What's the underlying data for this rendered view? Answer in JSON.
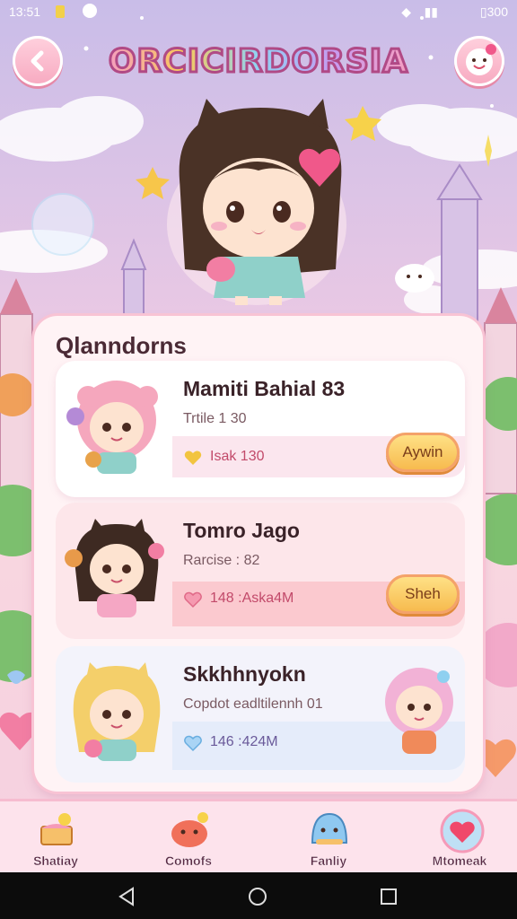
{
  "status_bar": {
    "time": "13:51",
    "battery": "300"
  },
  "header": {
    "logo_text": "ORCICIRDORSIA"
  },
  "panel": {
    "title": "Qlanndorns",
    "entries": [
      {
        "name": "Mamiti Bahial 83",
        "subtitle": "Trtile 1 30",
        "stat": "Isak 130",
        "stat_icon": "heart-gold-icon",
        "button_label": "Aywin"
      },
      {
        "name": "Tomro Jago",
        "subtitle": "Rarcise : 82",
        "stat": "148 :Aska4M",
        "stat_icon": "heart-pink-icon",
        "button_label": "Sheh"
      },
      {
        "name": "Skkhhnyokn",
        "subtitle": "Copdot eadltilennh 01",
        "stat": "146 :424M",
        "stat_icon": "heart-blue-icon"
      }
    ]
  },
  "bottom_nav": [
    {
      "label": "Shatiay",
      "icon": "cake-icon"
    },
    {
      "label": "Comofs",
      "icon": "mochi-icon"
    },
    {
      "label": "Fanliy",
      "icon": "slime-icon"
    },
    {
      "label": "Mtomeak",
      "icon": "heart-badge-icon"
    }
  ],
  "colors": {
    "accent": "#f6a7c1",
    "button": "#f6b84a",
    "text": "#3a2228"
  }
}
